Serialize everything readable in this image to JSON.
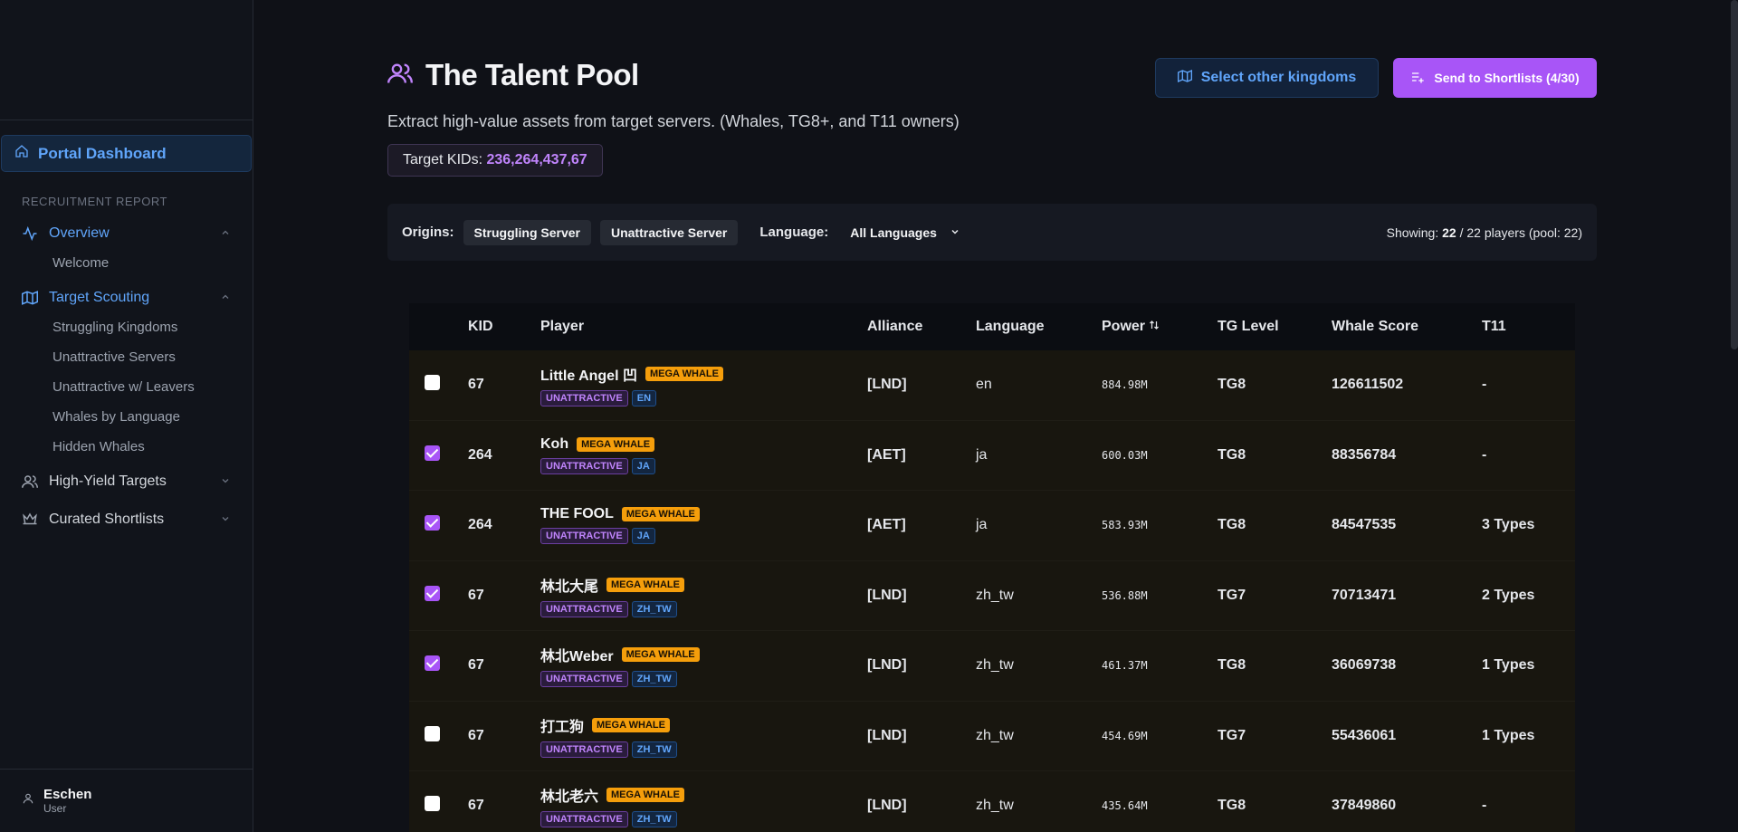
{
  "sidebar": {
    "portal_label": "Portal Dashboard",
    "section_label": "RECRUITMENT REPORT",
    "overview_label": "Overview",
    "overview_items": [
      "Welcome"
    ],
    "scouting_label": "Target Scouting",
    "scouting_items": [
      "Struggling Kingdoms",
      "Unattractive Servers",
      "Unattractive w/ Leavers",
      "Whales by Language",
      "Hidden Whales"
    ],
    "high_yield_label": "High-Yield Targets",
    "shortlists_label": "Curated Shortlists",
    "user_name": "Eschen",
    "user_role": "User"
  },
  "header": {
    "title": "The Talent Pool",
    "subtitle": "Extract high-value assets from target servers. (Whales, TG8+, and T11 owners)",
    "target_label": "Target KIDs:",
    "target_kids": "236,264,437,67",
    "select_button": "Select other kingdoms",
    "send_button": "Send to Shortlists (4/30)"
  },
  "filters": {
    "origins_label": "Origins:",
    "origins": [
      "Struggling Server",
      "Unattractive Server"
    ],
    "language_label": "Language:",
    "language_value": "All Languages",
    "showing_prefix": "Showing:",
    "showing_count": "22",
    "showing_suffix": "/ 22 players (pool: 22)"
  },
  "table": {
    "headers": {
      "kid": "KID",
      "player": "Player",
      "alliance": "Alliance",
      "language": "Language",
      "power": "Power",
      "tg": "TG Level",
      "whale": "Whale Score",
      "t11": "T11"
    },
    "rows": [
      {
        "checked": false,
        "kid": "67",
        "name": "Little Angel 凹",
        "badge": "MEGA WHALE",
        "tag": "UNATTRACTIVE",
        "lang_tag": "EN",
        "alliance": "[LND]",
        "language": "en",
        "power": "884.98M",
        "tg": "TG8",
        "whale": "126611502",
        "t11": "-"
      },
      {
        "checked": true,
        "kid": "264",
        "name": "Koh",
        "badge": "MEGA WHALE",
        "tag": "UNATTRACTIVE",
        "lang_tag": "JA",
        "alliance": "[AET]",
        "language": "ja",
        "power": "600.03M",
        "tg": "TG8",
        "whale": "88356784",
        "t11": "-"
      },
      {
        "checked": true,
        "kid": "264",
        "name": "THE FOOL",
        "badge": "MEGA WHALE",
        "tag": "UNATTRACTIVE",
        "lang_tag": "JA",
        "alliance": "[AET]",
        "language": "ja",
        "power": "583.93M",
        "tg": "TG8",
        "whale": "84547535",
        "t11": "3 Types"
      },
      {
        "checked": true,
        "kid": "67",
        "name": "林北大尾",
        "badge": "MEGA WHALE",
        "tag": "UNATTRACTIVE",
        "lang_tag": "ZH_TW",
        "alliance": "[LND]",
        "language": "zh_tw",
        "power": "536.88M",
        "tg": "TG7",
        "whale": "70713471",
        "t11": "2 Types"
      },
      {
        "checked": true,
        "kid": "67",
        "name": "林北Weber",
        "badge": "MEGA WHALE",
        "tag": "UNATTRACTIVE",
        "lang_tag": "ZH_TW",
        "alliance": "[LND]",
        "language": "zh_tw",
        "power": "461.37M",
        "tg": "TG8",
        "whale": "36069738",
        "t11": "1 Types"
      },
      {
        "checked": false,
        "kid": "67",
        "name": "打工狗",
        "badge": "MEGA WHALE",
        "tag": "UNATTRACTIVE",
        "lang_tag": "ZH_TW",
        "alliance": "[LND]",
        "language": "zh_tw",
        "power": "454.69M",
        "tg": "TG7",
        "whale": "55436061",
        "t11": "1 Types"
      },
      {
        "checked": false,
        "kid": "67",
        "name": "林北老六",
        "badge": "MEGA WHALE",
        "tag": "UNATTRACTIVE",
        "lang_tag": "ZH_TW",
        "alliance": "[LND]",
        "language": "zh_tw",
        "power": "435.64M",
        "tg": "TG8",
        "whale": "37849860",
        "t11": "-"
      }
    ]
  },
  "colors": {
    "accent": "#a855f7",
    "link": "#60a5fa",
    "mega": "#f59e0b"
  }
}
